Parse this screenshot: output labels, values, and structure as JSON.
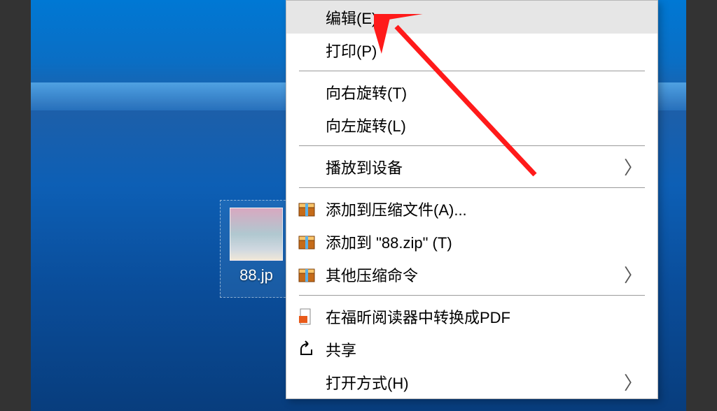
{
  "desktop": {
    "file_label": "88.jp"
  },
  "menu": {
    "edit": "编辑(E)",
    "print": "打印(P)",
    "rotate_right": "向右旋转(T)",
    "rotate_left": "向左旋转(L)",
    "cast": "播放到设备",
    "add_archive": "添加到压缩文件(A)...",
    "add_zip": "添加到 \"88.zip\" (T)",
    "other_compress": "其他压缩命令",
    "pdf": "在福昕阅读器中转换成PDF",
    "share": "共享",
    "open_with": "打开方式(H)"
  }
}
